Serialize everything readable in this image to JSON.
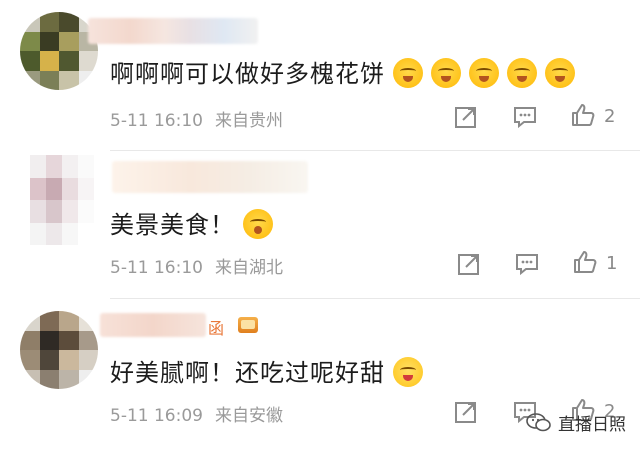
{
  "comments": [
    {
      "text": "啊啊啊可以做好多槐花饼",
      "emoji_name": "grin-laugh-emoji",
      "emoji_count": 5,
      "time": "5-11 16:10",
      "location": "来自贵州",
      "likes": "2"
    },
    {
      "text": "美景美食！",
      "emoji_name": "sweat-smile-emoji",
      "emoji_count": 1,
      "time": "5-11 16:10",
      "location": "来自湖北",
      "likes": "1"
    },
    {
      "text": "好美腻啊！还吃过呢好甜",
      "emoji_name": "tears-of-joy-emoji",
      "emoji_count": 1,
      "time": "5-11 16:09",
      "location": "来自安徽",
      "likes": "2",
      "name_suffix": "函"
    }
  ],
  "watermark": {
    "text": "直播日照"
  },
  "icons": {
    "share": "share-icon",
    "comment": "comment-icon",
    "like": "like-thumb-icon",
    "watermark_logo": "wechat-logo-icon",
    "vip": "crown-badge-icon"
  },
  "colors": {
    "text": "#1c1c1c",
    "meta": "#9a9a9a",
    "divider": "#e8e8e8"
  }
}
